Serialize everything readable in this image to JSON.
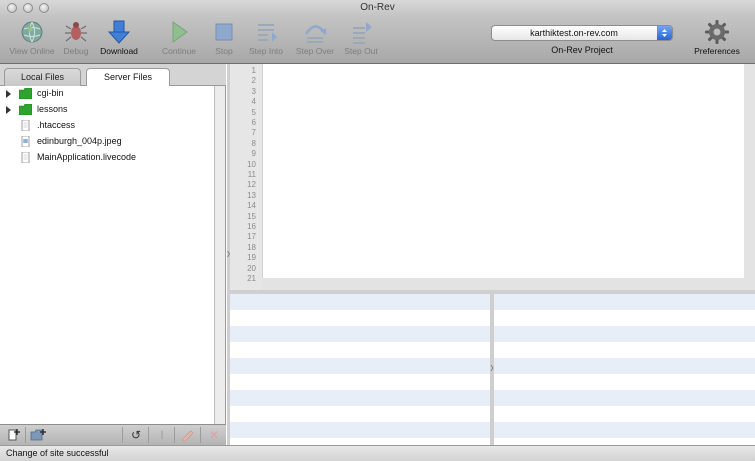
{
  "window": {
    "title": "On-Rev"
  },
  "toolbar": {
    "buttons": [
      {
        "id": "view-online",
        "label": "View Online",
        "icon": "globe-icon",
        "enabled": false
      },
      {
        "id": "debug",
        "label": "Debug",
        "icon": "bug-icon",
        "enabled": false
      },
      {
        "id": "download",
        "label": "Download",
        "icon": "download-arrow-icon",
        "enabled": true
      },
      {
        "id": "continue",
        "label": "Continue",
        "icon": "play-icon",
        "enabled": false
      },
      {
        "id": "stop",
        "label": "Stop",
        "icon": "stop-square-icon",
        "enabled": false
      },
      {
        "id": "step-into",
        "label": "Step Into",
        "icon": "step-into-icon",
        "enabled": false
      },
      {
        "id": "step-over",
        "label": "Step Over",
        "icon": "step-over-icon",
        "enabled": false
      },
      {
        "id": "step-out",
        "label": "Step Out",
        "icon": "step-out-icon",
        "enabled": false
      }
    ],
    "project": {
      "value": "karthiktest.on-rev.com",
      "label": "On-Rev Project"
    },
    "preferences_label": "Preferences"
  },
  "left_pane": {
    "tabs": [
      {
        "label": "Local Files",
        "active": false
      },
      {
        "label": "Server Files",
        "active": true
      }
    ],
    "files": [
      {
        "name": "cgi-bin",
        "type": "folder",
        "expandable": true
      },
      {
        "name": "lessons",
        "type": "folder",
        "expandable": true
      },
      {
        "name": ".htaccess",
        "type": "file",
        "expandable": false
      },
      {
        "name": "edinburgh_004p.jpeg",
        "type": "image",
        "expandable": false
      },
      {
        "name": "MainApplication.livecode",
        "type": "file",
        "expandable": false
      }
    ]
  },
  "editor": {
    "line_numbers": [
      "1",
      "2",
      "3",
      "4",
      "5",
      "6",
      "7",
      "8",
      "9",
      "10",
      "11",
      "12",
      "13",
      "14",
      "15",
      "16",
      "17",
      "18",
      "19",
      "20",
      "21"
    ]
  },
  "colors": {
    "folder_green": "#2fa32f",
    "stripe_blue": "#e8eef8",
    "select_blue": "#2a64d6"
  },
  "status": {
    "text": "Change of site successful"
  }
}
